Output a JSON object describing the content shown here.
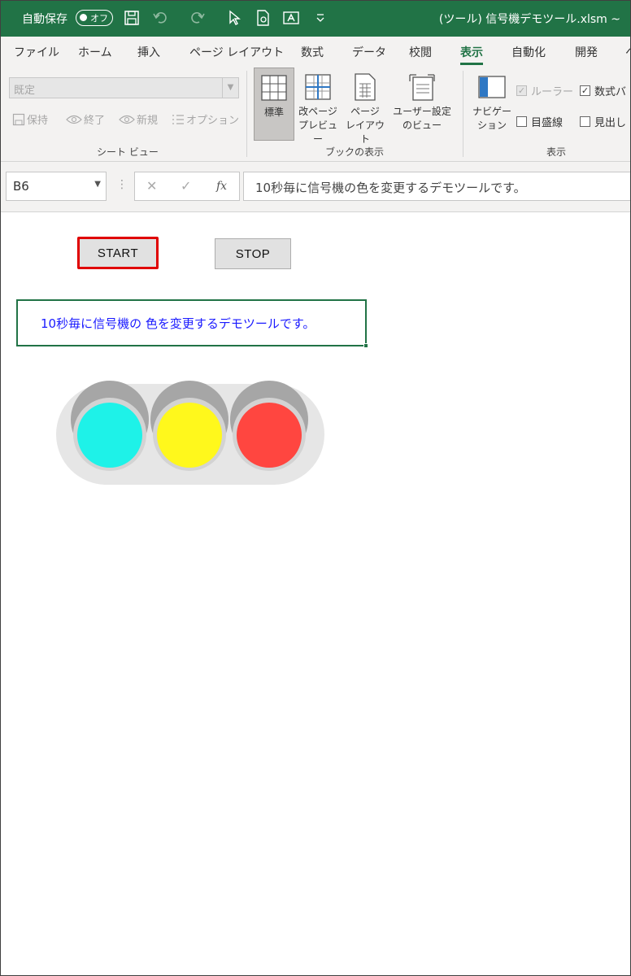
{
  "titlebar": {
    "autosave_label": "自動保存",
    "autosave_state": "オフ",
    "filename": "(ツール) 信号機デモツール.xlsm ~"
  },
  "ribbon_tabs": [
    "ファイル",
    "ホーム",
    "挿入",
    "ページ レイアウト",
    "数式",
    "データ",
    "校閲",
    "表示",
    "自動化",
    "開発",
    "ヘ"
  ],
  "active_tab": "表示",
  "sheet_view": {
    "select_value": "既定",
    "keep": "保持",
    "exit": "終了",
    "new": "新規",
    "options": "オプション",
    "group_label": "シート ビュー"
  },
  "workbook_views": {
    "normal": "標準",
    "page_break_1": "改ページ",
    "page_break_2": "プレビュー",
    "page_layout_1": "ページ",
    "page_layout_2": "レイアウト",
    "custom_1": "ユーザー設定",
    "custom_2": "のビュー",
    "group_label": "ブックの表示"
  },
  "show": {
    "navigation_1": "ナビゲー",
    "navigation_2": "ション",
    "ruler": "ルーラー",
    "gridlines": "目盛線",
    "formula_bar": "数式バ",
    "headings": "見出し",
    "group_label": "表示"
  },
  "formula_bar": {
    "cell_ref": "B6",
    "fx": "fx",
    "value": "10秒毎に信号機の色を変更するデモツールです。"
  },
  "sheet": {
    "start_label": "START",
    "stop_label": "STOP",
    "message": "10秒毎に信号機の 色を変更するデモツールです。"
  },
  "colors": {
    "excel_green": "#217346",
    "light_green": "#1ef2e8",
    "light_yellow": "#fff81c",
    "light_red": "#ff4640"
  }
}
